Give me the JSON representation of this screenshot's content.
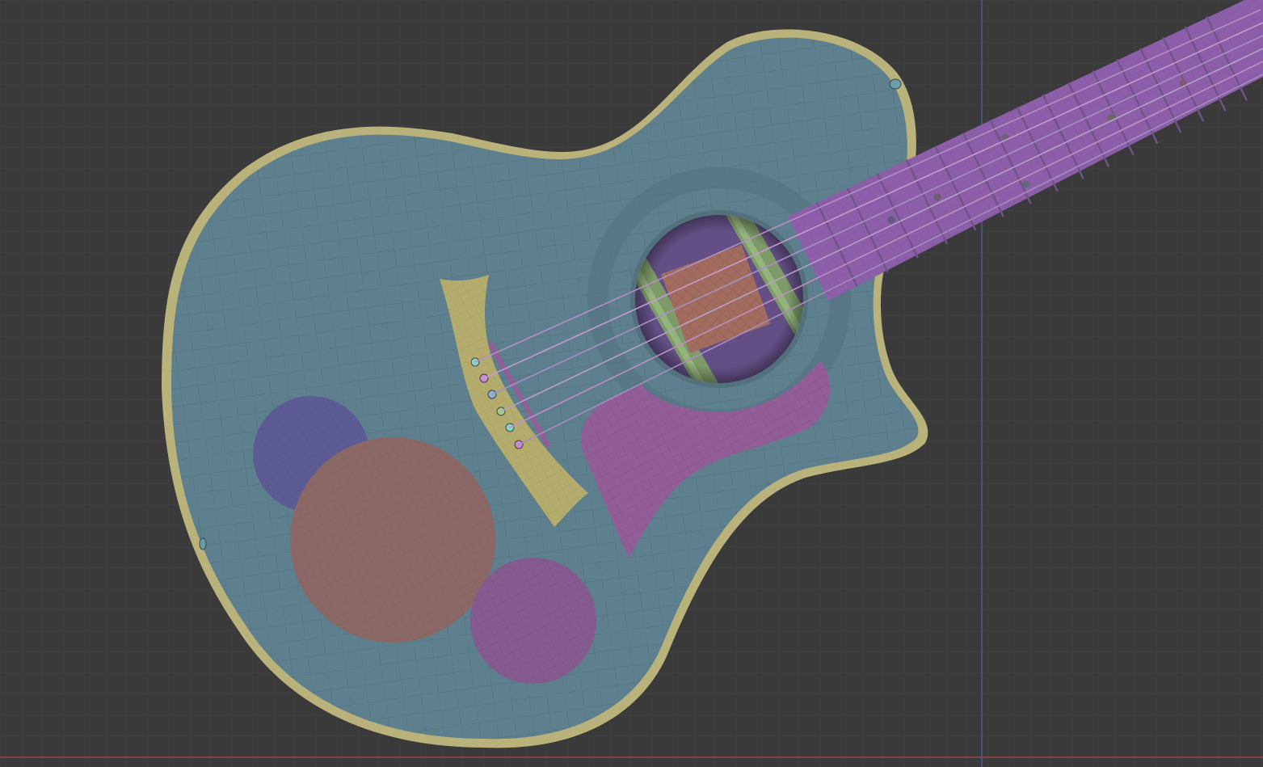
{
  "viewport": {
    "background": "#3a3a3a",
    "grid_color": "#444444",
    "axis_y_color": "#4a64a8",
    "axis_x_color": "#a8474a"
  },
  "model": {
    "subject": "guitar-mesh",
    "colors": {
      "top": "#5e7f8e",
      "binding": "#b9b27a",
      "fretboard": "#8d5ea9",
      "fret": "#6e5586",
      "bridge": "#b4ac6c",
      "pickguard": "#935d98",
      "pickup_block": "#a26c5f",
      "braces": "#7d9a68",
      "soundhole_inner": "#634f85",
      "disc_blue": "#5d5b94",
      "disc_orange": "#8b6866",
      "disc_purple": "#845a8f",
      "strap_button": "#6a9ea6"
    },
    "string_count": 6
  }
}
